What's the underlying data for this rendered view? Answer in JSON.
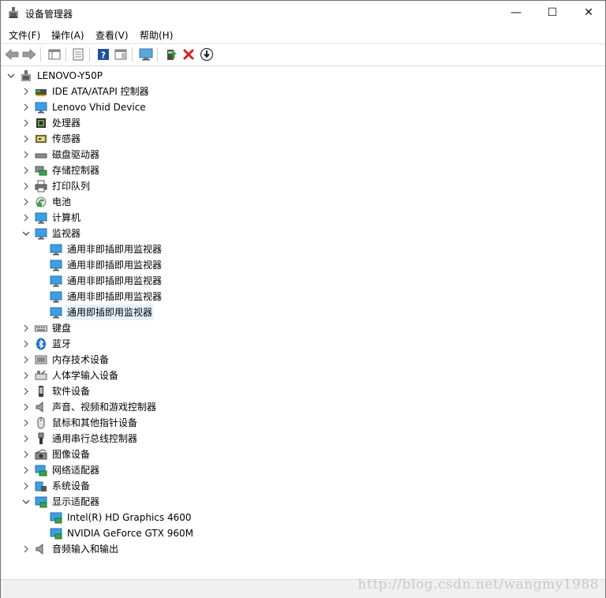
{
  "window": {
    "title": "设备管理器",
    "minimize": "—",
    "maximize": "☐",
    "close": "✕"
  },
  "menu": [
    {
      "label": "文件(F)"
    },
    {
      "label": "操作(A)"
    },
    {
      "label": "查看(V)"
    },
    {
      "label": "帮助(H)"
    }
  ],
  "toolbar": {
    "buttons": [
      "back-arrow",
      "forward-arrow",
      "properties-view",
      "properties-sheet",
      "help",
      "action-view",
      "scan-monitor",
      "update-driver",
      "uninstall",
      "disable-device"
    ]
  },
  "tree": {
    "root": "LENOVO-Y50P",
    "categories": [
      {
        "label": "IDE ATA/ATAPI 控制器",
        "icon": "ide-controller-icon",
        "expanded": false
      },
      {
        "label": "Lenovo Vhid Device",
        "icon": "monitor-icon",
        "expanded": false
      },
      {
        "label": "处理器",
        "icon": "processor-icon",
        "expanded": false
      },
      {
        "label": "传感器",
        "icon": "sensor-icon",
        "expanded": false
      },
      {
        "label": "磁盘驱动器",
        "icon": "disk-drive-icon",
        "expanded": false
      },
      {
        "label": "存储控制器",
        "icon": "storage-controller-icon",
        "expanded": false
      },
      {
        "label": "打印队列",
        "icon": "printer-icon",
        "expanded": false
      },
      {
        "label": "电池",
        "icon": "battery-icon",
        "expanded": false
      },
      {
        "label": "计算机",
        "icon": "computer-icon",
        "expanded": false
      },
      {
        "label": "监视器",
        "icon": "monitor-icon",
        "expanded": true,
        "children": [
          {
            "label": "通用非即插即用监视器",
            "selected": false
          },
          {
            "label": "通用非即插即用监视器",
            "selected": false
          },
          {
            "label": "通用非即插即用监视器",
            "selected": false
          },
          {
            "label": "通用非即插即用监视器",
            "selected": false
          },
          {
            "label": "通用即插即用监视器",
            "selected": true
          }
        ]
      },
      {
        "label": "键盘",
        "icon": "keyboard-icon",
        "expanded": false
      },
      {
        "label": "蓝牙",
        "icon": "bluetooth-icon",
        "expanded": false
      },
      {
        "label": "内存技术设备",
        "icon": "memory-device-icon",
        "expanded": false
      },
      {
        "label": "人体学输入设备",
        "icon": "hid-icon",
        "expanded": false
      },
      {
        "label": "软件设备",
        "icon": "software-device-icon",
        "expanded": false
      },
      {
        "label": "声音、视频和游戏控制器",
        "icon": "speaker-icon",
        "expanded": false
      },
      {
        "label": "鼠标和其他指针设备",
        "icon": "mouse-icon",
        "expanded": false
      },
      {
        "label": "通用串行总线控制器",
        "icon": "usb-icon",
        "expanded": false
      },
      {
        "label": "图像设备",
        "icon": "camera-icon",
        "expanded": false
      },
      {
        "label": "网络适配器",
        "icon": "network-adapter-icon",
        "expanded": false
      },
      {
        "label": "系统设备",
        "icon": "system-device-icon",
        "expanded": false
      },
      {
        "label": "显示适配器",
        "icon": "display-adapter-icon",
        "expanded": true,
        "children": [
          {
            "label": "Intel(R) HD Graphics 4600",
            "selected": false
          },
          {
            "label": "NVIDIA GeForce GTX 960M",
            "selected": false
          }
        ]
      },
      {
        "label": "音频输入和输出",
        "icon": "speaker-icon",
        "expanded": false
      }
    ]
  },
  "statusbar": {
    "watermark": "http://blog.csdn.net/wangmy1988"
  }
}
